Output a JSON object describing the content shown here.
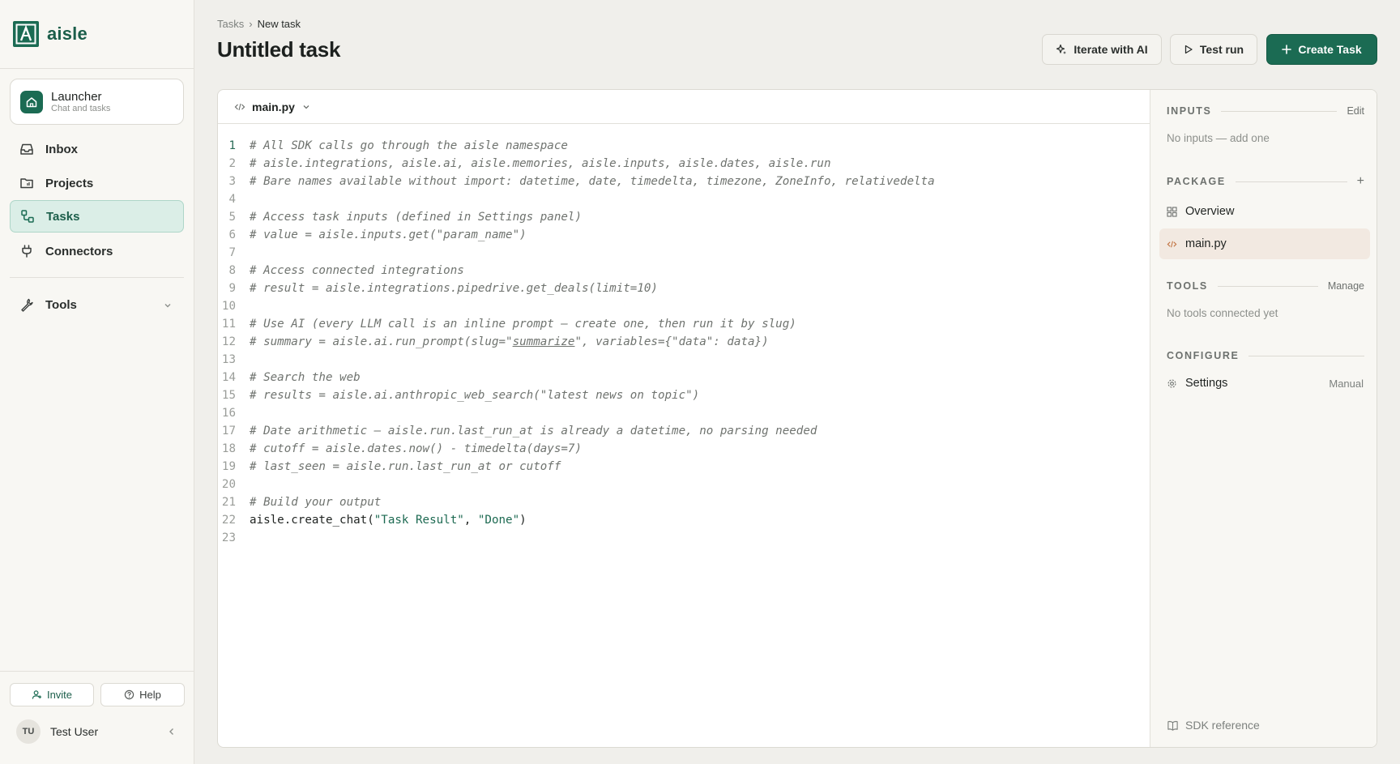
{
  "brand": {
    "name": "aisle"
  },
  "launcher": {
    "title": "Launcher",
    "subtitle": "Chat and tasks"
  },
  "nav": {
    "inbox": "Inbox",
    "projects": "Projects",
    "tasks": "Tasks",
    "connectors": "Connectors",
    "tools": "Tools"
  },
  "footer": {
    "invite": "Invite",
    "help": "Help",
    "user_initials": "TU",
    "user_name": "Test User"
  },
  "header": {
    "breadcrumb_root": "Tasks",
    "breadcrumb_sep": "›",
    "breadcrumb_current": "New task",
    "title": "Untitled task",
    "iterate_label": "Iterate with AI",
    "testrun_label": "Test run",
    "create_label": "Create Task"
  },
  "editor": {
    "file_name": "main.py",
    "lines": [
      "# All SDK calls go through the aisle namespace",
      "# aisle.integrations, aisle.ai, aisle.memories, aisle.inputs, aisle.dates, aisle.run",
      "# Bare names available without import: datetime, date, timedelta, timezone, ZoneInfo, relativedelta",
      "",
      "# Access task inputs (defined in Settings panel)",
      "# value = aisle.inputs.get(\"param_name\")",
      "",
      "# Access connected integrations",
      "# result = aisle.integrations.pipedrive.get_deals(limit=10)",
      "",
      "# Use AI (every LLM call is an inline prompt — create one, then run it by slug)",
      "# summary = aisle.ai.run_prompt(slug=\"summarize\", variables={\"data\": data})",
      "",
      "# Search the web",
      "# results = aisle.ai.anthropic_web_search(\"latest news on topic\")",
      "",
      "# Date arithmetic — aisle.run.last_run_at is already a datetime, no parsing needed",
      "# cutoff = aisle.dates.now() - timedelta(days=7)",
      "# last_seen = aisle.run.last_run_at or cutoff",
      "",
      "# Build your output",
      "aisle.create_chat(\"Task Result\", \"Done\")",
      ""
    ],
    "line12_parts": [
      "# summary = aisle.ai.run_prompt(slug=\"",
      "summarize",
      "\", variables={\"data\": data})"
    ],
    "line22_parts": [
      "aisle.create_chat(",
      "\"Task Result\"",
      ", ",
      "\"Done\"",
      ")"
    ]
  },
  "panel": {
    "inputs": {
      "title": "INPUTS",
      "action": "Edit",
      "empty": "No inputs — add one"
    },
    "package": {
      "title": "PACKAGE",
      "action": "+",
      "items": [
        "Overview",
        "main.py"
      ]
    },
    "tools": {
      "title": "TOOLS",
      "action": "Manage",
      "empty": "No tools connected yet"
    },
    "configure": {
      "title": "CONFIGURE",
      "item": "Settings",
      "item_value": "Manual"
    },
    "sdk_reference": "SDK reference"
  },
  "colors": {
    "accent": "#1b6b53",
    "accent_light": "#dbeee7",
    "selected_file": "#f2e9e1"
  }
}
